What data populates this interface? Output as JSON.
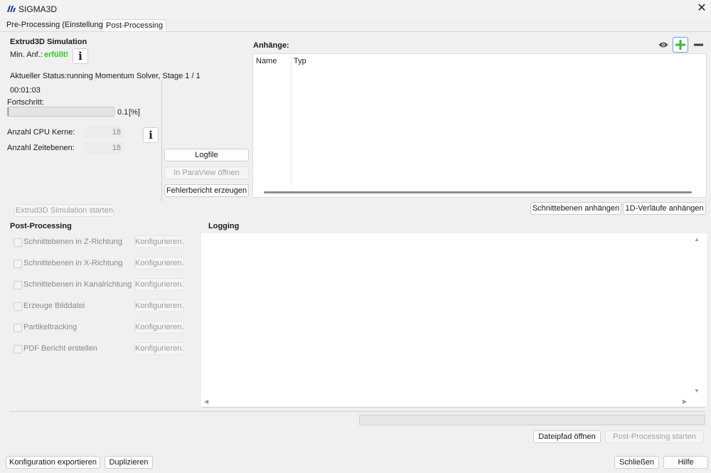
{
  "window": {
    "title": "SIGMA3D",
    "close_glyph": "✕",
    "brand_color": "#1c2f8c"
  },
  "tabs": [
    {
      "label": "Pre-Processing (Einstellungen)",
      "active": false
    },
    {
      "label": "Post-Processing",
      "active": true
    }
  ],
  "simulation": {
    "heading": "Extrud3D Simulation",
    "min_label": "Min. Anf.:",
    "min_value": "erfüllt!",
    "status_label": "Aktueller Status:",
    "status_value": "running Momentum Solver, Stage 1 / 1",
    "elapsed": "00:01:03",
    "progress_label": "Fortschritt:",
    "progress_value": "0.1",
    "progress_unit": "[%]",
    "progress_fraction": 0.001,
    "cpu_label": "Anzahl CPU Kerne:",
    "cpu_value": "18",
    "time_label": "Anzahl Zeitebenen:",
    "time_value": "18",
    "info_glyph": "i",
    "start_button": "Extrud3D Simulation starten"
  },
  "actions": {
    "logfile": "Logfile",
    "paraview": "In ParaView öffnen",
    "error_report": "Fehlerbericht erzeugen"
  },
  "attachments": {
    "heading": "Anhänge:",
    "columns": [
      "Name",
      "Typ"
    ],
    "add_button": "Schnittebenen anhängen",
    "add_1d_button": "1D-Verläufe anhängen"
  },
  "postprocessing": {
    "heading": "Post-Processing",
    "configure_label": "Konfigurieren...",
    "items": [
      {
        "label": "Schnittebenen in Z-Richtung"
      },
      {
        "label": "Schnittebenen in X-Richtung"
      },
      {
        "label": "Schnittebenen in Kanalrichtung"
      },
      {
        "label": "Erzeuge Bilddatei"
      },
      {
        "label": "Partikeltracking"
      },
      {
        "label": "PDF Bericht erstellen"
      }
    ]
  },
  "logging": {
    "heading": "Logging",
    "open_path_button": "Dateipfad öffnen",
    "start_pp_button": "Post-Processing starten"
  },
  "footer": {
    "export_button": "Konfiguration exportieren",
    "duplicate_button": "Duplizieren",
    "close_button": "Schließen",
    "help_button": "Hilfe"
  }
}
